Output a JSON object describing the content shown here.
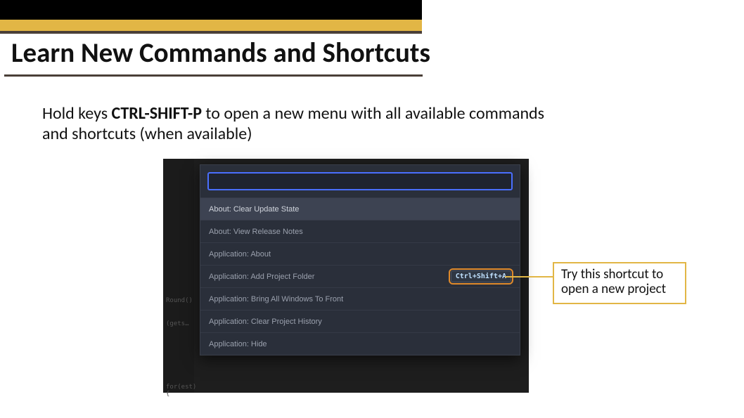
{
  "title": "Learn New Commands and Shortcuts",
  "intro": {
    "pre": "Hold keys ",
    "keys": "CTRL-SHIFT-P",
    "post": " to open a new menu with all available commands and shortcuts (when available)"
  },
  "palette": {
    "items": [
      {
        "label": "About: Clear Update State",
        "shortcut": ""
      },
      {
        "label": "About: View Release Notes",
        "shortcut": ""
      },
      {
        "label": "Application: About",
        "shortcut": ""
      },
      {
        "label": "Application: Add Project Folder",
        "shortcut": "Ctrl+Shift+A"
      },
      {
        "label": "Application: Bring All Windows To Front",
        "shortcut": ""
      },
      {
        "label": "Application: Clear Project History",
        "shortcut": ""
      },
      {
        "label": "Application: Hide",
        "shortcut": ""
      }
    ]
  },
  "code_snips": {
    "s1": "Round()",
    "s2": "(gets…",
    "s3": "for(est) {"
  },
  "callout": "Try this shortcut to open a new project"
}
